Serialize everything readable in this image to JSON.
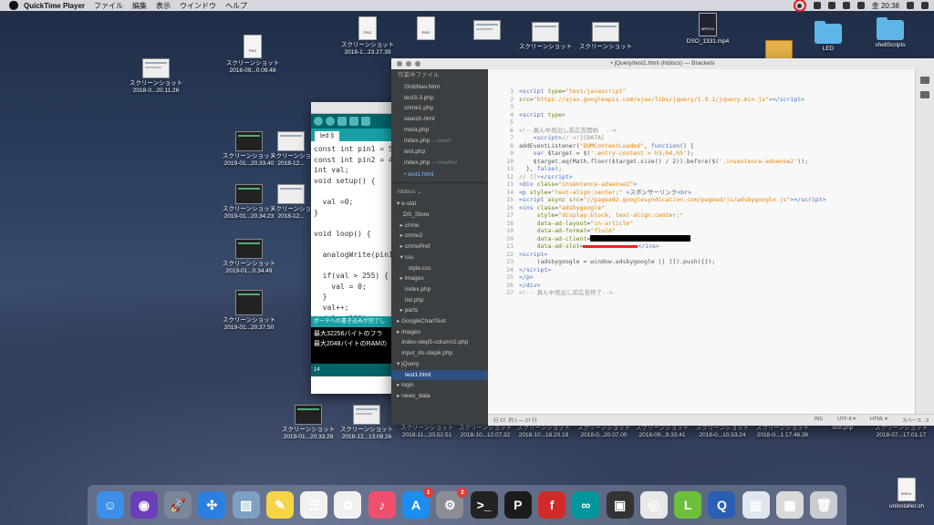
{
  "menubar": {
    "app_name": "QuickTime Player",
    "items": [
      "ファイル",
      "編集",
      "表示",
      "ウインドウ",
      "ヘルプ"
    ],
    "clock": "金 20:38"
  },
  "desktop": {
    "screenshot_label": "スクリーンショット",
    "icons": [
      {
        "date": "2018-0...20.11.26"
      },
      {
        "date": "2018-09...0.09.48"
      },
      {
        "date": "2018-1...23.27.39"
      },
      {
        "date": "2019-01...20.33.40"
      },
      {
        "date": "2018-12..."
      },
      {
        "date": "2019-01...20.34.23"
      },
      {
        "date": "2018-12..."
      },
      {
        "date": "2019-01...0.34.49"
      },
      {
        "date": "2019-01...20.37.50"
      },
      {
        "date": "2019-01...20.33.28"
      },
      {
        "date": "2018-12...13.08.26"
      },
      {
        "date": "2018-11...20.52.51"
      },
      {
        "date": "2018-10...12.07.32"
      },
      {
        "date": "2018-10...18.20.19"
      },
      {
        "date": "2018-0...20.07.00"
      },
      {
        "date": "2018-09...9.33.41"
      },
      {
        "date": "2018-0...10.53.24"
      },
      {
        "date": "2018-0...1 17.46.36"
      }
    ],
    "named_icons": {
      "dso": "DSO_1331.mp4",
      "led": "LED",
      "shell_scripts": "shellScripts",
      "test_php": "test.php",
      "last_date": "2018-07...17.01.17",
      "uninstaller": "uninstaller.sh",
      "png_tag": "PNG",
      "mpeg_tag": "MPEG4",
      "shell_tag": "SHELL"
    }
  },
  "arduino": {
    "tab": "led §",
    "code": "const int pin1 = 5;\nconst int pin2 = 4;\nint val;\nvoid setup() {\n\n  val =0;\n}\n\nvoid loop() {\n\n  analogWrite(pin1\n\n  if(val > 255) {\n    val = 0;\n  }\n  val++;\n  delay(100);",
    "status": "ボードへの書き込みが完了し",
    "console": [
      "最大32256バイトのフラ",
      "最大2048バイトのRAMの"
    ],
    "footer": "14"
  },
  "brackets": {
    "title": "• jQuery/test1.html (htdocs) — Brackets",
    "working_files_header": "作業中ファイル",
    "working_files": [
      {
        "name": "GlobNav.html",
        "extra": ""
      },
      {
        "name": "test3-3.php",
        "extra": ""
      },
      {
        "name": "crime1.php",
        "extra": ""
      },
      {
        "name": "search.html",
        "extra": ""
      },
      {
        "name": "meta.php",
        "extra": ""
      },
      {
        "name": "index.php",
        "extra": "— crime2"
      },
      {
        "name": "test.php",
        "extra": ""
      },
      {
        "name": "index.php",
        "extra": "— crimePref"
      },
      {
        "name": "• test1.html",
        "extra": ""
      }
    ],
    "project_header": "htdocs ⌄",
    "tree": [
      "▾ e-stat",
      "   .DS_Store",
      "  ▸ crime",
      "  ▸ crime2",
      "  ▸ crimePref",
      "  ▾ css",
      "       style.css",
      "  ▸ images",
      "     index.php",
      "     list.php",
      "  ▸ parts",
      "▸ GoogleChartTest",
      "▸ images",
      "   index-step5-column2.php",
      "   input_do-step6.php",
      "▾ jQuery",
      "     test1.html",
      "▸ login",
      "▸ news_data"
    ],
    "selected_tree_item": "     test1.html",
    "status": {
      "cursor": "行 27, 列 1 — 27 行",
      "ins": "INS",
      "enc": "UTF-8 ▾",
      "lang": "HTML ▾",
      "spaces": "スペース : 3"
    },
    "line_count": 27
  },
  "dock": {
    "apps": [
      {
        "name": "finder-icon",
        "color": "#3d8ee8",
        "glyph": "☺",
        "badge": ""
      },
      {
        "name": "siri-icon",
        "color": "#6a3fb8",
        "glyph": "◉",
        "badge": ""
      },
      {
        "name": "launchpad-icon",
        "color": "#7a8799",
        "glyph": "🚀",
        "badge": ""
      },
      {
        "name": "safari-icon",
        "color": "#2a7fe0",
        "glyph": "✣",
        "badge": ""
      },
      {
        "name": "preview-icon",
        "color": "#7da0c4",
        "glyph": "▨",
        "badge": ""
      },
      {
        "name": "notes-icon",
        "color": "#f5d547",
        "glyph": "✎",
        "badge": ""
      },
      {
        "name": "reminders-icon",
        "color": "#f1f1f1",
        "glyph": "☰",
        "badge": ""
      },
      {
        "name": "photos-icon",
        "color": "#f0f0f0",
        "glyph": "✿",
        "badge": ""
      },
      {
        "name": "music-icon",
        "color": "#f0506e",
        "glyph": "♪",
        "badge": ""
      },
      {
        "name": "appstore-icon",
        "color": "#1c8ef0",
        "glyph": "A",
        "badge": "1"
      },
      {
        "name": "system-preferences-icon",
        "color": "#8a8d93",
        "glyph": "⚙",
        "badge": "2"
      },
      {
        "name": "terminal-icon",
        "color": "#222222",
        "glyph": ">_",
        "badge": ""
      },
      {
        "name": "p3-icon",
        "color": "#1b1b1b",
        "glyph": "P",
        "badge": ""
      },
      {
        "name": "fritzing-icon",
        "color": "#d22a2a",
        "glyph": "f",
        "badge": ""
      },
      {
        "name": "arduino-icon",
        "color": "#00979c",
        "glyph": "∞",
        "badge": ""
      },
      {
        "name": "blackmagic-icon",
        "color": "#333333",
        "glyph": "▣",
        "badge": ""
      },
      {
        "name": "chrome-icon",
        "color": "#e8e8e8",
        "glyph": "◎",
        "badge": ""
      },
      {
        "name": "lcov-icon",
        "color": "#6cbf3a",
        "glyph": "L",
        "badge": ""
      },
      {
        "name": "quicktime-icon",
        "color": "#2a5fb4",
        "glyph": "Q",
        "badge": ""
      },
      {
        "name": "document-stack-icon",
        "color": "#dfe6ef",
        "glyph": "▤",
        "badge": ""
      },
      {
        "name": "screenshot-stack-icon",
        "color": "#d9d9d9",
        "glyph": "▦",
        "badge": ""
      },
      {
        "name": "trash-icon",
        "color": "#c9ccd1",
        "glyph": "🗑",
        "badge": ""
      }
    ]
  }
}
